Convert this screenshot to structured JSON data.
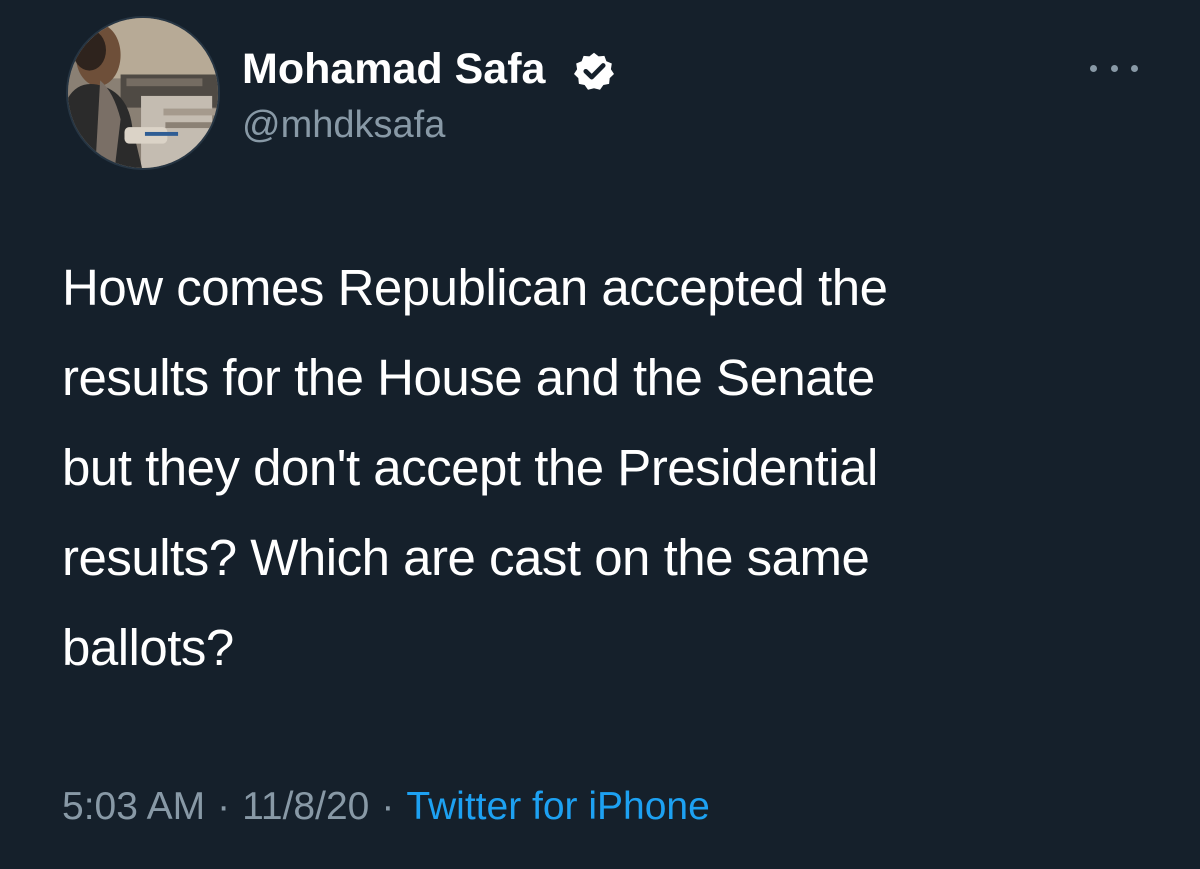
{
  "colors": {
    "background": "#15202b",
    "primary_text": "#ffffff",
    "secondary_text": "#8899a6",
    "accent": "#1da1f2"
  },
  "tweet": {
    "author": {
      "name": "Mohamad Safa",
      "handle": "@mhdksafa",
      "verified": true,
      "avatar_icon": "profile-photo"
    },
    "more_icon": "more-horizontal-icon",
    "text": "How comes Republican accepted the\nresults for the House and the Senate\nbut they don't accept the Presidential\nresults? Which are cast on the same\nballots?",
    "meta": {
      "time": "5:03 AM",
      "separator": "·",
      "date": "11/8/20",
      "source": "Twitter for iPhone"
    }
  }
}
